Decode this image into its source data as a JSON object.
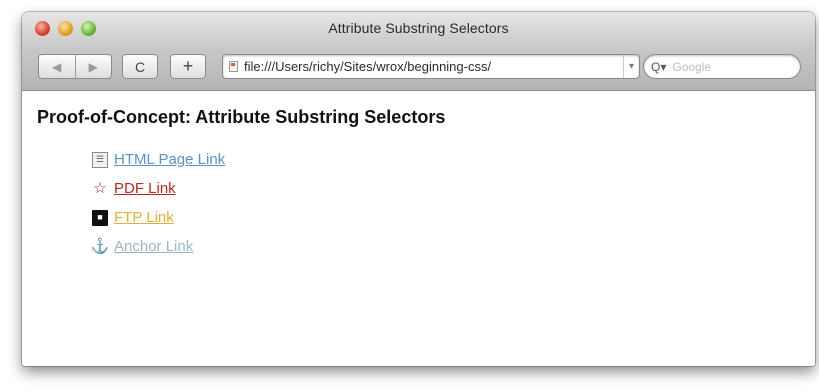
{
  "window": {
    "title": "Attribute Substring Selectors"
  },
  "toolbar": {
    "back_glyph": "◀",
    "forward_glyph": "▶",
    "reload_glyph": "C",
    "add_glyph": "+",
    "address_url": "file:///Users/richy/Sites/wrox/beginning-css/",
    "address_end_glyph": "▾",
    "search_glyph": "Q▾",
    "search_placeholder": "Google"
  },
  "page": {
    "heading": "Proof-of-Concept: Attribute Substring Selectors",
    "links": [
      {
        "label": "HTML Page Link",
        "icon": "html-page-icon",
        "color": "#5b93c4"
      },
      {
        "label": "PDF Link",
        "icon": "pdf-icon",
        "color": "#c0281c"
      },
      {
        "label": "FTP Link",
        "icon": "floppy-disk-icon",
        "color": "#e0b330"
      },
      {
        "label": "Anchor Link",
        "icon": "anchor-icon",
        "color": "#9bb6cb"
      }
    ]
  }
}
